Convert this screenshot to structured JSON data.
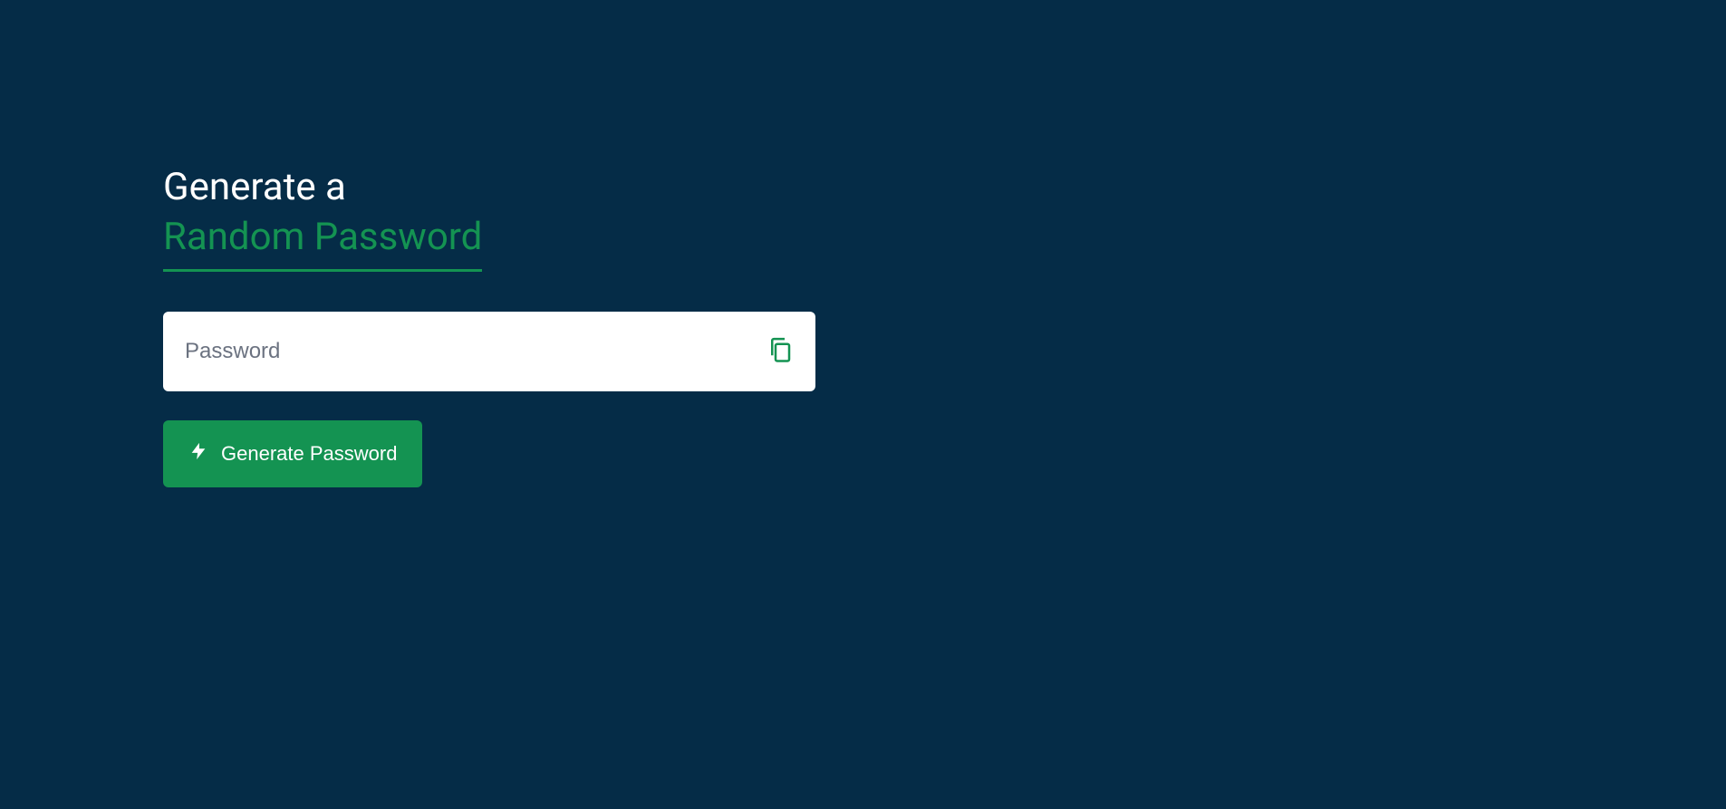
{
  "heading": {
    "line1": "Generate a",
    "line2": "Random Password"
  },
  "input": {
    "placeholder": "Password",
    "value": ""
  },
  "button": {
    "label": "Generate Password"
  },
  "colors": {
    "background": "#052c47",
    "accent": "#149352",
    "white": "#ffffff"
  }
}
